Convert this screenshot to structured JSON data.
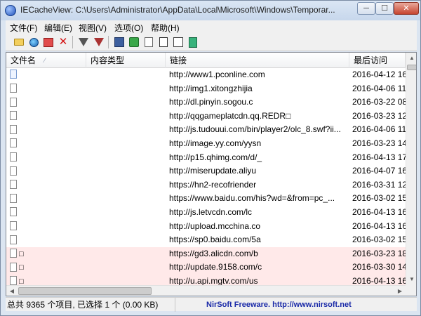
{
  "window": {
    "title": "IECacheView:  C:\\Users\\Administrator\\AppData\\Local\\Microsoft\\Windows\\Temporar...",
    "min_glyph": "─",
    "max_glyph": "☐",
    "close_glyph": "✕"
  },
  "menu": [
    "文件(F)",
    "编辑(E)",
    "视图(V)",
    "选项(O)",
    "帮助(H)"
  ],
  "toolbar": {
    "icons": [
      "open-folder-icon",
      "globe-icon",
      "copy-url-icon",
      "delete-icon",
      "filter-icon",
      "filter-remove-icon",
      "save-icon",
      "refresh-icon",
      "copy-icon",
      "report-icon",
      "properties-icon",
      "exit-icon"
    ],
    "delete_glyph": "✕"
  },
  "columns": {
    "filename": "文件名",
    "sort_arrow": "⁄",
    "content_type": "内容类型",
    "url": "链接",
    "last_accessed": "最后访问"
  },
  "rows": [
    {
      "name": "",
      "type": "",
      "url": "http://www1.pconline.com",
      "date": "2016-04-12 16",
      "pink": false
    },
    {
      "name": "",
      "type": "",
      "url": "http://img1.xitongzhijia",
      "date": "2016-04-06 11",
      "pink": false
    },
    {
      "name": "",
      "type": "",
      "url": "http://dl.pinyin.sogou.c",
      "date": "2016-03-22 08",
      "pink": false
    },
    {
      "name": "",
      "type": "",
      "url": "http://qqgameplatcdn.qq.REDR□",
      "date": "2016-03-23 12",
      "pink": false
    },
    {
      "name": "",
      "type": "",
      "url": "http://js.tudouui.com/bin/player2/olc_8.swf?ii...",
      "date": "2016-04-06 11",
      "pink": false
    },
    {
      "name": "",
      "type": "",
      "url": "http://image.yy.com/yysn",
      "date": "2016-03-23 14",
      "pink": false
    },
    {
      "name": "",
      "type": "",
      "url": "http://p15.qhimg.com/d/_",
      "date": "2016-04-13 17",
      "pink": false
    },
    {
      "name": "",
      "type": "",
      "url": "http://miserupdate.aliyu",
      "date": "2016-04-07 16",
      "pink": false
    },
    {
      "name": "",
      "type": "",
      "url": "https://hn2-recofriender",
      "date": "2016-03-31 12",
      "pink": false
    },
    {
      "name": "",
      "type": "",
      "url": "https://www.baidu.com/his?wd=&from=pc_...",
      "date": "2016-03-02 15",
      "pink": false
    },
    {
      "name": "",
      "type": "",
      "url": "http://js.letvcdn.com/lc",
      "date": "2016-04-13 16",
      "pink": false
    },
    {
      "name": "",
      "type": "",
      "url": "http://upload.mcchina.co",
      "date": "2016-04-13 16",
      "pink": false
    },
    {
      "name": "",
      "type": "",
      "url": "https://sp0.baidu.com/5a",
      "date": "2016-03-02 15",
      "pink": false
    },
    {
      "name": "□",
      "type": "",
      "url": "https://gd3.alicdn.com/b",
      "date": "2016-03-23 18",
      "pink": true
    },
    {
      "name": "□",
      "type": "",
      "url": "http://update.9158.com/c",
      "date": "2016-03-30 14",
      "pink": true
    },
    {
      "name": "□",
      "type": "",
      "url": "http://u.api.mgtv.com/us",
      "date": "2016-04-13 16",
      "pink": true
    }
  ],
  "scrollbar": {
    "up": "▲",
    "down": "▼",
    "left": "◀",
    "right": "▶"
  },
  "status": {
    "left": "总共 9365 个项目, 已选择 1 个  (0.00 KB)",
    "right": "NirSoft Freeware.  http://www.nirsoft.net"
  }
}
